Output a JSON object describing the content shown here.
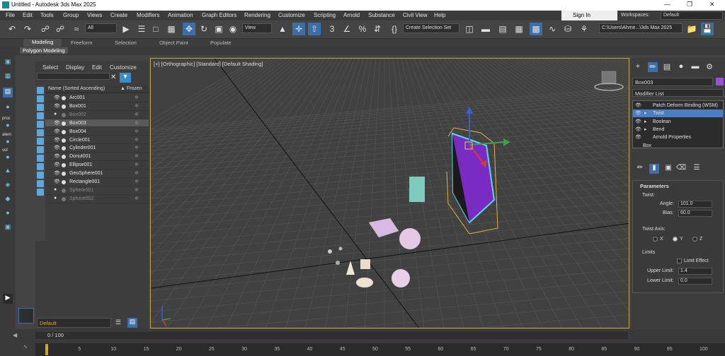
{
  "window": {
    "title": "Untitled - Autodesk 3ds Max 2025"
  },
  "menu": [
    "File",
    "Edit",
    "Tools",
    "Group",
    "Views",
    "Create",
    "Modifiers",
    "Animation",
    "Graph Editors",
    "Rendering",
    "Customize",
    "Scripting",
    "Arnold",
    "Substance",
    "Civil View",
    "Help"
  ],
  "account": {
    "signin": "Sign In",
    "workspaces_label": "Workspaces:",
    "workspace": "Default"
  },
  "toolbar": {
    "filter": "All",
    "viewcoord": "View",
    "selection_set": "Create Selection Set",
    "project_path": "C:\\Users\\Ahme...\\3ds Max 2025"
  },
  "ribbon": {
    "tabs": [
      "Modeling",
      "Freeform",
      "Selection",
      "Object Paint",
      "Populate"
    ],
    "sub": "Polygon Modeling"
  },
  "left_labels": [
    "proc",
    "alem",
    "vol"
  ],
  "scene_explorer": {
    "menu": [
      "Select",
      "Display",
      "Edit",
      "Customize"
    ],
    "col_name": "Name (Sorted Ascending)",
    "col_frozen": "▲ Frozen",
    "rows": [
      {
        "name": "Arc001",
        "hidden": false,
        "selected": false
      },
      {
        "name": "Box001",
        "hidden": false,
        "selected": false
      },
      {
        "name": "Box002",
        "hidden": true,
        "selected": false
      },
      {
        "name": "Box003",
        "hidden": false,
        "selected": true
      },
      {
        "name": "Box004",
        "hidden": false,
        "selected": false
      },
      {
        "name": "Circle001",
        "hidden": false,
        "selected": false
      },
      {
        "name": "Cylinder001",
        "hidden": false,
        "selected": false
      },
      {
        "name": "Donut001",
        "hidden": false,
        "selected": false
      },
      {
        "name": "Ellipse001",
        "hidden": false,
        "selected": false
      },
      {
        "name": "GeoSphere001",
        "hidden": false,
        "selected": false
      },
      {
        "name": "Rectangle001",
        "hidden": false,
        "selected": false
      },
      {
        "name": "Sphere001",
        "hidden": true,
        "selected": false
      },
      {
        "name": "Sphere002",
        "hidden": true,
        "selected": false
      }
    ],
    "layer": "Default"
  },
  "viewport": {
    "label": "[+] [Orthographic] [Standard] [Default Shading]"
  },
  "command_panel": {
    "object_name": "Box003",
    "object_color": "#9a4fd6",
    "modifier_list": "Modifier List",
    "stack": [
      {
        "label": "Patch Deform Binding (WSM)",
        "selected": false,
        "eye": true
      },
      {
        "label": "Twist",
        "selected": true,
        "eye": true
      },
      {
        "label": "Boolean",
        "selected": false,
        "eye": true
      },
      {
        "label": "Bend",
        "selected": false,
        "eye": true
      },
      {
        "label": "Arnold Properties",
        "selected": false,
        "eye": true
      },
      {
        "label": "Box",
        "selected": false,
        "eye": false
      }
    ],
    "params": {
      "title": "Parameters",
      "twist_label": "Twist:",
      "angle_label": "Angle:",
      "angle": "101.0",
      "bias_label": "Bias:",
      "bias": "60.0",
      "axis_label": "Twist Axis:",
      "axes": [
        "X",
        "Y",
        "Z"
      ],
      "selected_axis": "Y",
      "limits_label": "Limits",
      "limit_effect": "Limit Effect",
      "upper_label": "Upper Limit:",
      "upper": "1.4",
      "lower_label": "Lower Limit:",
      "lower": "0.0"
    }
  },
  "timeline": {
    "frame": "0 / 100",
    "ticks": [
      "0",
      "5",
      "10",
      "15",
      "20",
      "25",
      "30",
      "35",
      "40",
      "45",
      "50",
      "55",
      "60",
      "65",
      "70",
      "75",
      "80",
      "85",
      "90",
      "95",
      "100"
    ]
  },
  "colors": {
    "accent": "#3c6fa8",
    "viewport_border": "#c8a44a",
    "selection": "#9a4fd6"
  }
}
